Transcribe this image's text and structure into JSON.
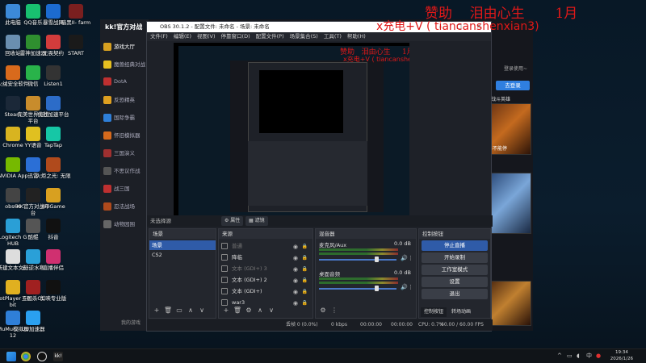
{
  "desktop": {
    "icons": [
      {
        "label": "此电脑",
        "color": "#3c8ad8"
      },
      {
        "label": "QQ音乐",
        "color": "#18c070"
      },
      {
        "label": "暴雪战网",
        "color": "#1c6bd0"
      },
      {
        "label": "暗黑II- farm",
        "color": "#7a1f1f"
      },
      {
        "label": "回收站",
        "color": "#6a8fb0"
      },
      {
        "label": "雷神加速器",
        "color": "#2f8f2f"
      },
      {
        "label": "无畏契约",
        "color": "#d23c3c"
      },
      {
        "label": "START",
        "color": "#1a1a1a"
      },
      {
        "label": "火绒安全软件",
        "color": "#d86a1c"
      },
      {
        "label": "微信",
        "color": "#29b34a"
      },
      {
        "label": "Listen1",
        "color": "#333"
      },
      {
        "label": "Steam",
        "color": "#1b2838"
      },
      {
        "label": "完美世界竞技平台",
        "color": "#c88c2c"
      },
      {
        "label": "优社加速平台",
        "color": "#2c6cc8"
      },
      {
        "label": "Chrome",
        "color": "#d8b420"
      },
      {
        "label": "YY语音",
        "color": "#e0c020"
      },
      {
        "label": "TapTap",
        "color": "#16c7a6"
      },
      {
        "label": "NVIDIA App",
        "color": "#76b900"
      },
      {
        "label": "迅雷",
        "color": "#2b6fd6"
      },
      {
        "label": "火炬之光: 无限",
        "color": "#b04a1c"
      },
      {
        "label": "obs64",
        "color": "#444"
      },
      {
        "label": "KK官方对战平台",
        "color": "#222"
      },
      {
        "label": "WeGame",
        "color": "#d8a020"
      },
      {
        "label": "Logitech G HUB",
        "color": "#2a9fd6"
      },
      {
        "label": "酷鲲",
        "color": "#555"
      },
      {
        "label": "抖音",
        "color": "#111"
      },
      {
        "label": "新建文本文档",
        "color": "#ddd"
      },
      {
        "label": "云·逆水寒",
        "color": "#2aa0d8"
      },
      {
        "label": "直播伴侣",
        "color": "#d03070"
      },
      {
        "label": "PotPlayer 64 bit",
        "color": "#e0b020"
      },
      {
        "label": "三国杀OL",
        "color": "#a02020"
      },
      {
        "label": "剪映专业版",
        "color": "#111"
      },
      {
        "label": "MuMu模拟器12",
        "color": "#2f7fd8"
      },
      {
        "label": "UU加速器",
        "color": "#2aa0f0"
      }
    ]
  },
  "overlay": {
    "line1_a": "赞助",
    "line1_b": "泪由心生",
    "line1_c": "1月",
    "line2": "x充电+V ( tiancanshenxian3)"
  },
  "kk": {
    "logo": "kk!官方对战",
    "items": [
      "游戏大厅",
      "魔兽经典对战",
      "DotA",
      "反恐精英",
      "国际争霸",
      "怀旧模拟器",
      "三国演义",
      "不思议作战",
      "战三国",
      "忍法战场",
      "动物园围"
    ],
    "login_text": "登录使用~",
    "login_button": "去登录",
    "hero_label": "战斗英雄",
    "tag_new": "卡不能停",
    "bottom_link": "我的游戏"
  },
  "obs": {
    "title": "OBS 30.1.2 - 配置文件: 未命名 - 场景: 未命名",
    "menu": [
      "文件(F)",
      "编辑(E)",
      "视图(V)",
      "停靠窗口(D)",
      "配置文件(P)",
      "场景集合(S)",
      "工具(T)",
      "帮助(H)"
    ],
    "source_status": "未选择源",
    "props_button": "属性",
    "filters_button": "滤镜",
    "scenes": {
      "header": "场景",
      "items": [
        "场景",
        "CS2"
      ]
    },
    "sources": {
      "header": "来源",
      "items": [
        {
          "name": "普通",
          "dim": true
        },
        {
          "name": "降临",
          "dim": false
        },
        {
          "name": "文本 (GDI+) 3",
          "dim": true
        },
        {
          "name": "文本 (GDI+) 2",
          "dim": false
        },
        {
          "name": "文本 (GDI+)",
          "dim": false
        },
        {
          "name": "war3",
          "dim": false
        }
      ]
    },
    "mixer": {
      "header": "混音器",
      "channels": [
        {
          "name": "麦克风/Aux",
          "db": "0.0 dB",
          "level": 0.72
        },
        {
          "name": "桌面音频",
          "db": "0.0 dB",
          "level": 0.72
        }
      ]
    },
    "controls": {
      "header": "控制按钮",
      "buttons": [
        "停止直播",
        "开始录制",
        "工作室模式",
        "设置",
        "退出"
      ],
      "tabs": [
        "控制按钮",
        "转场动画"
      ]
    },
    "status": {
      "frames": "丢帧 0 (0.0%)",
      "bitrate": "0 kbps",
      "live_time": "00:00:00",
      "rec_time": "00:00:00",
      "cpu": "CPU: 0.7%",
      "fps": "60.00 / 60.00 FPS"
    }
  },
  "taskbar": {
    "time": "19:34",
    "date": "2026/1/26"
  }
}
